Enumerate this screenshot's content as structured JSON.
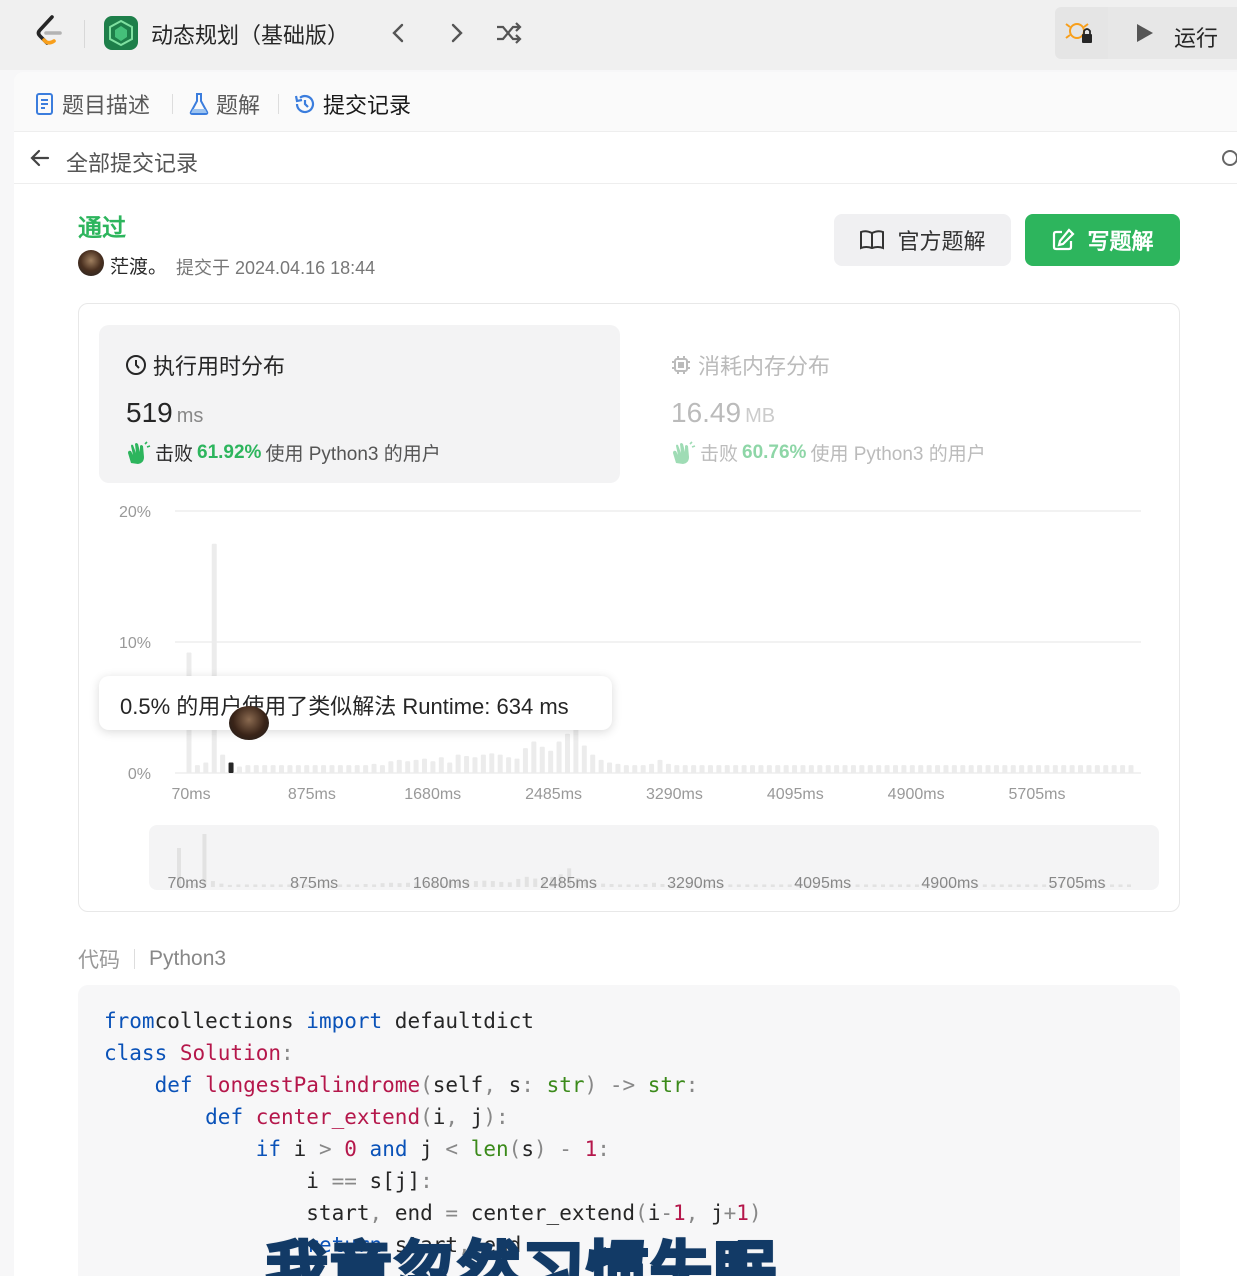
{
  "topbar": {
    "study_title": "动态规划（基础版）",
    "prev_icon": "chevron-left-icon",
    "next_icon": "chevron-right-icon",
    "shuffle_icon": "shuffle-icon",
    "debug_icon": "debug-lock-icon",
    "run_label": "运行"
  },
  "tabs": [
    {
      "label": "题目描述",
      "icon": "description-icon"
    },
    {
      "label": "题解",
      "icon": "flask-icon"
    },
    {
      "label": "提交记录",
      "icon": "history-icon"
    }
  ],
  "back": {
    "label": "全部提交记录"
  },
  "submission": {
    "status": "通过",
    "author": "茫渡。",
    "submitted_at": "提交于 2024.04.16 18:44",
    "official_solution_label": "官方题解",
    "write_solution_label": "写题解"
  },
  "runtime": {
    "title": "执行用时分布",
    "value": "519",
    "unit": "ms",
    "beat_prefix": "击败",
    "beat_pct": "61.92%",
    "beat_suffix": "使用 Python3 的用户"
  },
  "memory": {
    "title": "消耗内存分布",
    "value": "16.49",
    "unit": "MB",
    "beat_prefix": "击败",
    "beat_pct": "60.76%",
    "beat_suffix": "使用 Python3 的用户"
  },
  "tooltip": {
    "text": "0.5% 的用户使用了类似解法 Runtime: 634 ms"
  },
  "chart_data": {
    "type": "bar",
    "ylabels": [
      "20%",
      "10%",
      "0%"
    ],
    "ylim": [
      0,
      20
    ],
    "xticks": [
      "70ms",
      "875ms",
      "1680ms",
      "2485ms",
      "3290ms",
      "4095ms",
      "4900ms",
      "5705ms"
    ],
    "values": [
      9.2,
      0.6,
      0.8,
      17.5,
      1.4,
      0.8,
      0.5,
      0.6,
      0.6,
      0.6,
      0.6,
      0.6,
      0.6,
      0.6,
      0.6,
      0.6,
      0.6,
      0.6,
      0.6,
      0.6,
      0.6,
      0.6,
      0.7,
      0.6,
      0.9,
      1.0,
      0.9,
      1.0,
      1.1,
      0.9,
      1.2,
      0.8,
      1.4,
      1.3,
      1.2,
      1.4,
      1.5,
      1.4,
      1.2,
      1.1,
      1.9,
      2.4,
      2.0,
      1.7,
      2.4,
      3.0,
      4.4,
      2.1,
      1.4,
      1.0,
      0.8,
      0.7,
      0.6,
      0.6,
      0.6,
      0.7,
      1.0,
      0.7,
      0.6,
      0.6,
      0.6,
      0.6,
      0.6,
      0.6,
      0.6,
      0.6,
      0.6,
      0.6,
      0.6,
      0.6,
      0.6,
      0.6,
      0.6,
      0.6,
      0.6,
      0.6,
      0.6,
      0.6,
      0.6,
      0.6,
      0.6,
      0.6,
      0.6,
      0.6,
      0.6,
      0.6,
      0.6,
      0.6,
      0.6,
      0.6,
      0.6,
      0.6,
      0.6,
      0.6,
      0.6,
      0.6,
      0.6,
      0.6,
      0.6,
      0.6,
      0.6,
      0.6,
      0.6,
      0.6,
      0.6,
      0.6,
      0.6,
      0.6,
      0.6,
      0.6,
      0.6,
      0.6,
      0.6
    ],
    "highlight_index": 5,
    "highlight_value": 0.8,
    "bar_color": "#ececec",
    "highlight_color": "#262626",
    "grid": true
  },
  "code": {
    "label": "代码",
    "language": "Python3",
    "lines": [
      [
        [
          "kw",
          "from"
        ],
        [
          "",
          "collections "
        ],
        [
          "kw",
          "import"
        ],
        [
          "",
          " defaultdict"
        ]
      ],
      [
        [
          "kw",
          "class"
        ],
        [
          "cls",
          " Solution"
        ],
        [
          "op",
          ":"
        ]
      ],
      [
        [
          "",
          "    "
        ],
        [
          "kw",
          "def"
        ],
        [
          "fn",
          " longestPalindrome"
        ],
        [
          "op",
          "("
        ],
        [
          "",
          "self"
        ],
        [
          "op",
          ","
        ],
        [
          "",
          " s"
        ],
        [
          "op",
          ":"
        ],
        [
          "ty",
          " str"
        ],
        [
          "op",
          ")"
        ],
        [
          "op",
          " ->"
        ],
        [
          "ty",
          " str"
        ],
        [
          "op",
          ":"
        ]
      ],
      [
        [
          "",
          "        "
        ],
        [
          "kw",
          "def"
        ],
        [
          "fn",
          " center_extend"
        ],
        [
          "op",
          "("
        ],
        [
          "",
          "i"
        ],
        [
          "op",
          ","
        ],
        [
          "",
          " j"
        ],
        [
          "op",
          "):"
        ]
      ],
      [
        [
          "",
          "            "
        ],
        [
          "kw",
          "if"
        ],
        [
          "",
          " i "
        ],
        [
          "op",
          ">"
        ],
        [
          "nu",
          " 0"
        ],
        [
          "kw",
          " and"
        ],
        [
          "",
          " j "
        ],
        [
          "op",
          "<"
        ],
        [
          "ty",
          " len"
        ],
        [
          "op",
          "("
        ],
        [
          "",
          "s"
        ],
        [
          "op",
          ")"
        ],
        [
          "op",
          " -"
        ],
        [
          "nu",
          " 1"
        ],
        [
          "op",
          ":"
        ]
      ],
      [
        [
          "",
          "                i "
        ],
        [
          "op",
          "=="
        ],
        [
          "",
          " s[j]"
        ],
        [
          "op",
          ":"
        ]
      ],
      [
        [
          "",
          "                start"
        ],
        [
          "op",
          ","
        ],
        [
          "",
          " end "
        ],
        [
          "op",
          "="
        ],
        [
          "",
          " center_extend"
        ],
        [
          "op",
          "("
        ],
        [
          "",
          "i"
        ],
        [
          "op",
          "-"
        ],
        [
          "nu",
          "1"
        ],
        [
          "op",
          ","
        ],
        [
          "",
          " j"
        ],
        [
          "op",
          "+"
        ],
        [
          "nu",
          "1"
        ],
        [
          "op",
          ")"
        ]
      ],
      [
        [
          "",
          "                "
        ],
        [
          "kw",
          "return"
        ],
        [
          "",
          " start"
        ],
        [
          "op",
          ","
        ],
        [
          "",
          " end"
        ]
      ]
    ]
  },
  "subtitle": {
    "text": "我竟忽然习惯失眠"
  }
}
